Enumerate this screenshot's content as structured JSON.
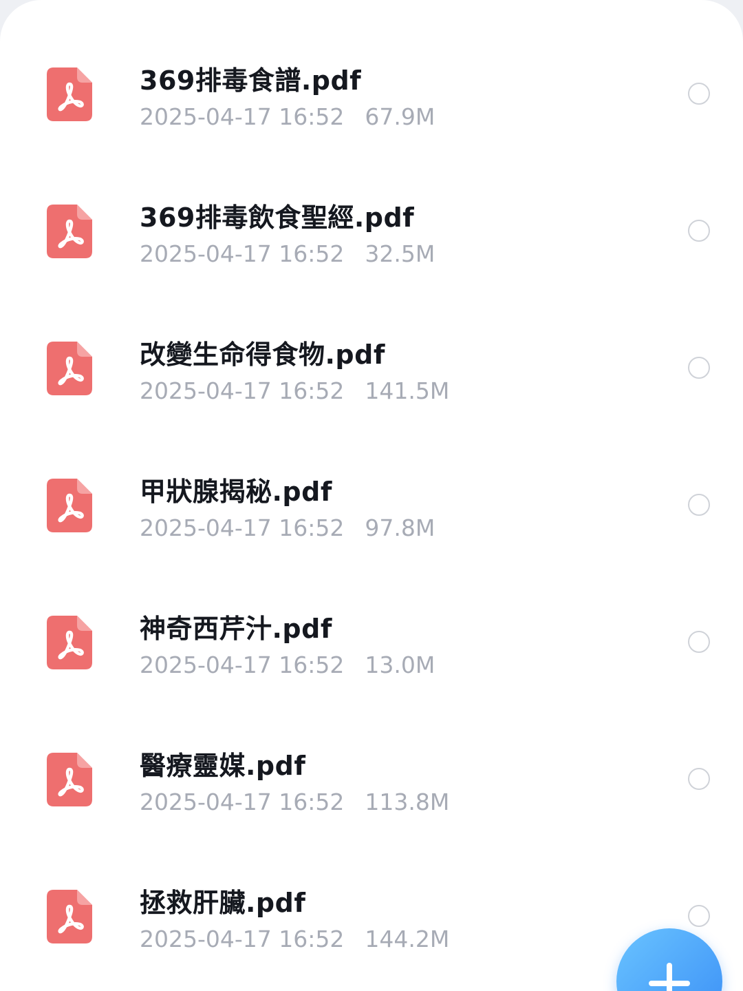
{
  "colors": {
    "pdf_icon": "#ee6f6f",
    "fab_start": "#69c3ff",
    "fab_end": "#3a8ef6",
    "meta_text": "#a7abb5",
    "title_text": "#15181f"
  },
  "files": [
    {
      "name": "369排毒食譜.pdf",
      "date": "2025-04-17 16:52",
      "size": "67.9M",
      "icon": "pdf-icon",
      "selected": false
    },
    {
      "name": "369排毒飲食聖經.pdf",
      "date": "2025-04-17 16:52",
      "size": "32.5M",
      "icon": "pdf-icon",
      "selected": false
    },
    {
      "name": "改變生命得食物.pdf",
      "date": "2025-04-17 16:52",
      "size": "141.5M",
      "icon": "pdf-icon",
      "selected": false
    },
    {
      "name": "甲狀腺揭秘.pdf",
      "date": "2025-04-17 16:52",
      "size": "97.8M",
      "icon": "pdf-icon",
      "selected": false
    },
    {
      "name": "神奇西芹汁.pdf",
      "date": "2025-04-17 16:52",
      "size": "13.0M",
      "icon": "pdf-icon",
      "selected": false
    },
    {
      "name": "醫療靈媒.pdf",
      "date": "2025-04-17 16:52",
      "size": "113.8M",
      "icon": "pdf-icon",
      "selected": false
    },
    {
      "name": "拯救肝臟.pdf",
      "date": "2025-04-17 16:52",
      "size": "144.2M",
      "icon": "pdf-icon",
      "selected": false
    }
  ],
  "fab": {
    "icon": "plus-icon"
  }
}
